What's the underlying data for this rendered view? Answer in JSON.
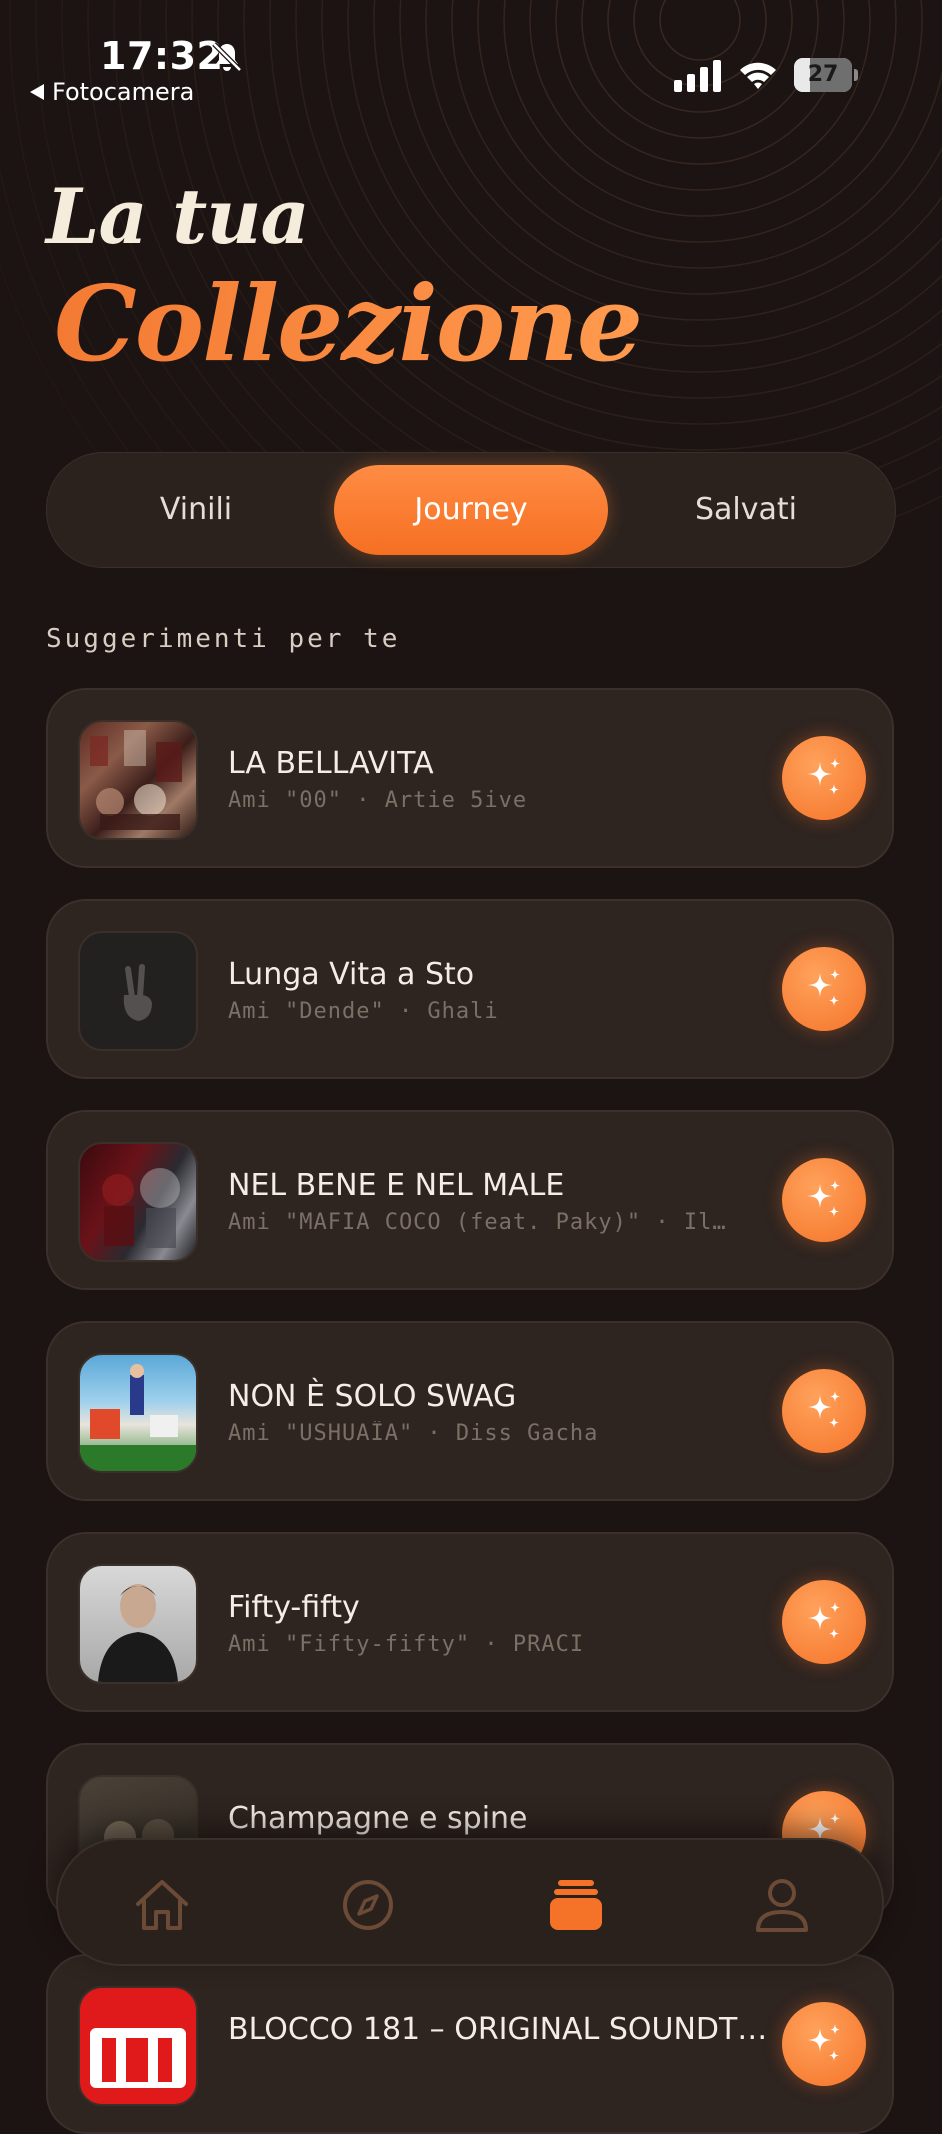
{
  "status_bar": {
    "time": "17:32",
    "back_app": "Fotocamera",
    "battery": "27",
    "battery_level": 0.27
  },
  "header": {
    "title_line1": "La tua",
    "title_line2": "Collezione"
  },
  "tabs": [
    {
      "label": "Vinili",
      "active": false
    },
    {
      "label": "Journey",
      "active": true
    },
    {
      "label": "Salvati",
      "active": false
    }
  ],
  "section_label": "Suggerimenti per te",
  "suggestions": [
    {
      "title": "LA BELLAVITA",
      "subtitle": "Ami \"00\" · Artie 5ive"
    },
    {
      "title": "Lunga Vita a Sto",
      "subtitle": "Ami \"Dende\" · Ghali"
    },
    {
      "title": "NEL BENE E NEL MALE",
      "subtitle": "Ami \"MAFIA COCO (feat. Paky)\" · Il…"
    },
    {
      "title": "NON È SOLO SWAG",
      "subtitle": "Ami \"USHUAÏA\" · Diss Gacha"
    },
    {
      "title": "Fifty-fifty",
      "subtitle": "Ami \"Fifty-fifty\" · PRACI"
    },
    {
      "title": "Champagne e spine",
      "subtitle": ""
    },
    {
      "title": "BLOCCO 181 – ORIGINAL SOUNDT…",
      "subtitle": ""
    }
  ],
  "bottom_nav": [
    {
      "icon": "home-icon",
      "active": false
    },
    {
      "icon": "compass-icon",
      "active": false
    },
    {
      "icon": "collection-stack-icon",
      "active": true
    },
    {
      "icon": "profile-icon",
      "active": false
    }
  ],
  "colors": {
    "accent": "#f57328",
    "background": "#1c1412",
    "card": "#2e2420",
    "nav_inactive": "#6b4a36"
  }
}
